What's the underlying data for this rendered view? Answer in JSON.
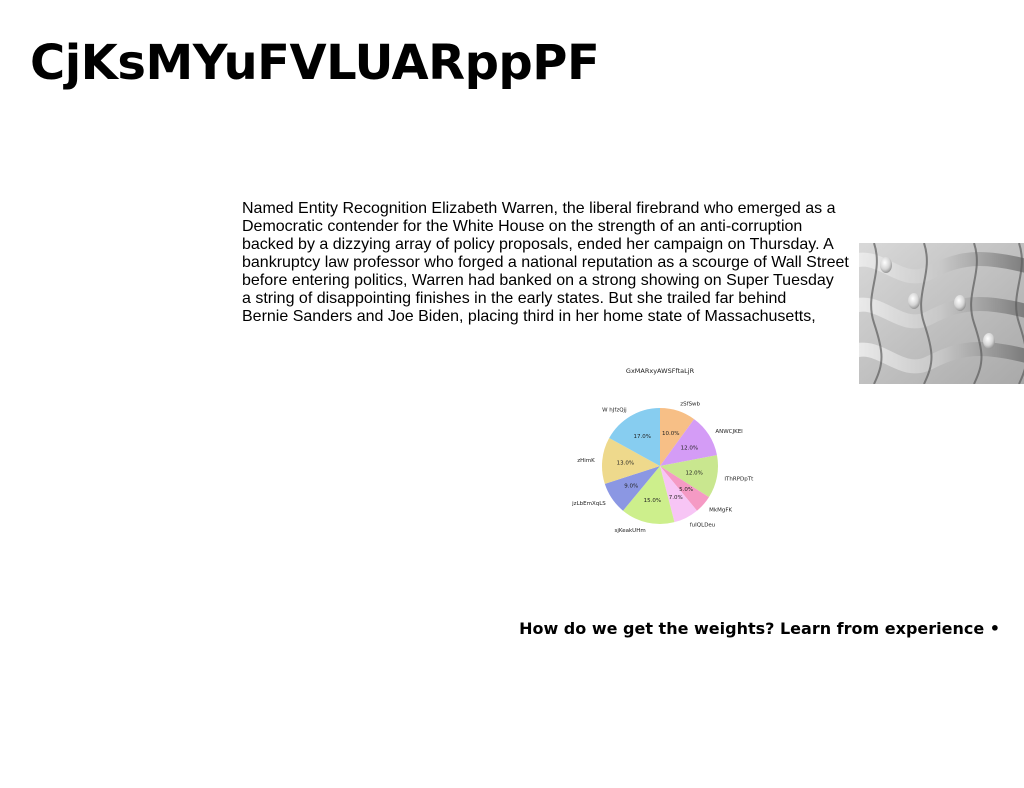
{
  "page": {
    "title": "CjKsMYuFVLUARppPF",
    "paragraph_lines": [
      "Named Entity Recognition Elizabeth Warren, the liberal firebrand who emerged as a",
      "Democratic contender for the White House on the strength of an anti-corruption",
      "backed by a dizzying array of policy proposals, ended her campaign on Thursday. A",
      "bankruptcy law professor who forged a national reputation as a scourge of Wall Street",
      "before entering politics, Warren had banked on a strong showing on Super Tuesday",
      "a string of disappointing finishes in the early states. But she trailed far behind",
      "Bernie Sanders and Joe Biden, placing third in her home state of Massachusetts,"
    ],
    "caption": "How do we get the weights? Learn from experience •"
  },
  "chart_data": {
    "type": "pie",
    "title": "GxMARxyAWSFftaLjR",
    "slices": [
      {
        "label": "zSfSwb",
        "value": 10.0,
        "color": "#f7bf86"
      },
      {
        "label": "ANWCJKEI",
        "value": 12.0,
        "color": "#d49cf6"
      },
      {
        "label": "IThRPDpTt",
        "value": 12.0,
        "color": "#c9e78f"
      },
      {
        "label": "MkMgFK",
        "value": 5.0,
        "color": "#f59ac4"
      },
      {
        "label": "fuIQLDeu",
        "value": 7.0,
        "color": "#f7c5f5"
      },
      {
        "label": "sjKeakUHm",
        "value": 15.0,
        "color": "#cdef8c"
      },
      {
        "label": "jzLbEmXqLS",
        "value": 9.0,
        "color": "#8b97e3"
      },
      {
        "label": "zHimK",
        "value": 13.0,
        "color": "#eed98c"
      },
      {
        "label": "W hJfzQjj",
        "value": 17.0,
        "color": "#87cdf0"
      }
    ],
    "start_angle_deg": 90,
    "direction": "clockwise"
  }
}
